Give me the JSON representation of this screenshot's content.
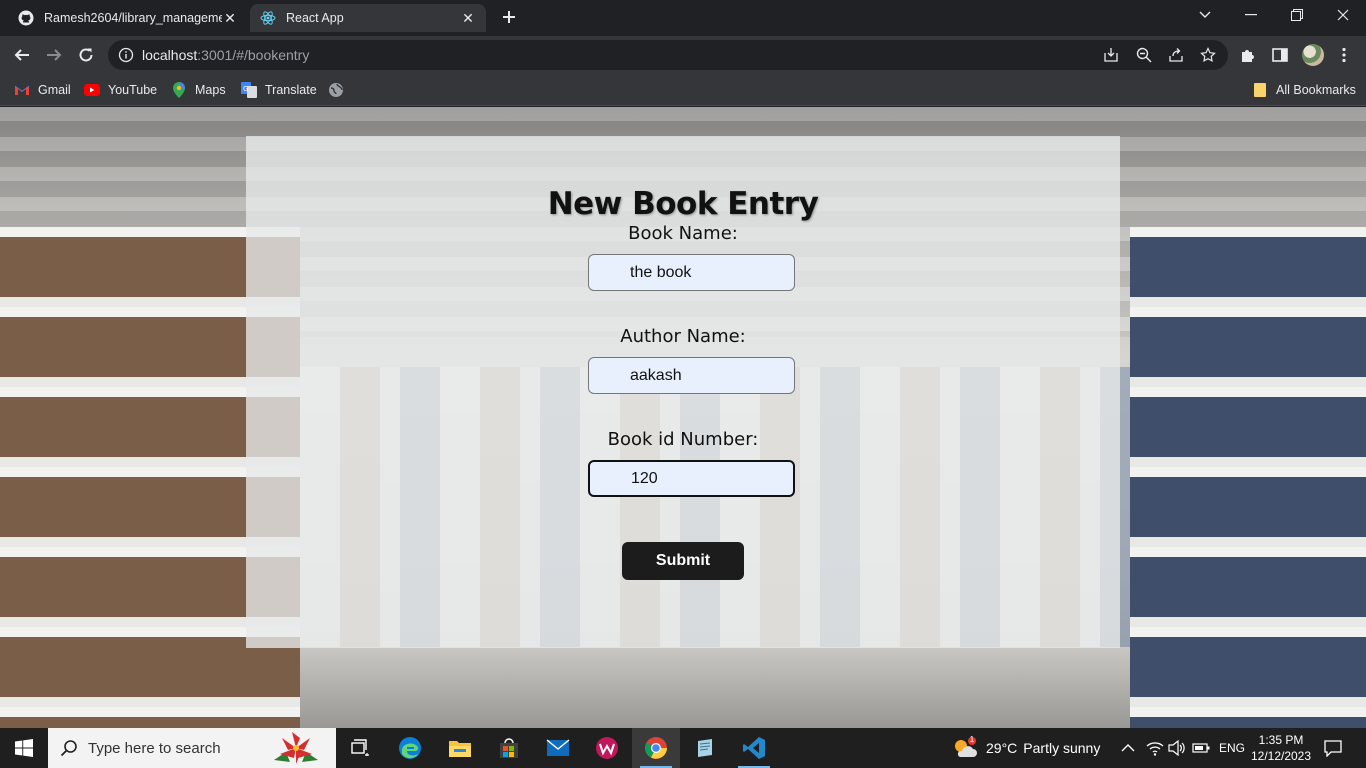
{
  "browser": {
    "tabs": [
      {
        "title": "Ramesh2604/library_manageme",
        "active": false,
        "icon": "github-icon"
      },
      {
        "title": "React App",
        "active": true,
        "icon": "react-icon"
      }
    ],
    "url": {
      "host": "localhost",
      "path": ":3001/#/bookentry"
    },
    "bookmarks": [
      {
        "label": "Gmail",
        "icon": "gmail-icon"
      },
      {
        "label": "YouTube",
        "icon": "youtube-icon"
      },
      {
        "label": "Maps",
        "icon": "maps-icon"
      },
      {
        "label": "Translate",
        "icon": "translate-icon"
      },
      {
        "label": "",
        "icon": "globe-icon"
      }
    ],
    "all_bookmarks": "All Bookmarks"
  },
  "page": {
    "title": "New Book Entry",
    "fields": [
      {
        "label": "Book Name:",
        "value": "the book"
      },
      {
        "label": "Author Name:",
        "value": "aakash"
      },
      {
        "label": "Book id Number:",
        "value": "120",
        "focused": true
      }
    ],
    "submit_label": "Submit"
  },
  "taskbar": {
    "search_placeholder": "Type here to search",
    "weather": {
      "temp": "29°C",
      "condition": "Partly sunny",
      "badge": "1"
    },
    "language": "ENG",
    "time": "1:35 PM",
    "date": "12/12/2023"
  },
  "colors": {
    "accent_active_indicator": "#76b9ed",
    "panel_bg": "#e8eaea",
    "input_bg": "#e8f0fe",
    "button_bg": "#1c1c1c"
  }
}
